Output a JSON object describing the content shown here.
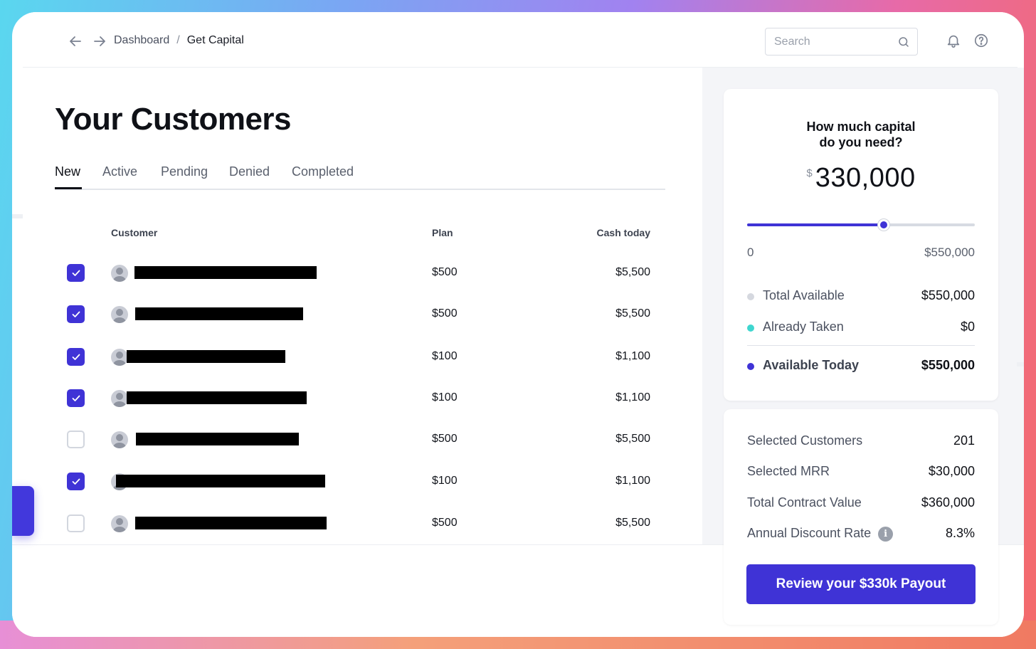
{
  "breadcrumb": {
    "parent": "Dashboard",
    "separator": "/",
    "current": "Get Capital"
  },
  "search": {
    "placeholder": "Search",
    "value": ""
  },
  "page": {
    "title": "Your Customers"
  },
  "tabs": [
    {
      "label": "New",
      "active": true
    },
    {
      "label": "Active",
      "active": false
    },
    {
      "label": "Pending",
      "active": false
    },
    {
      "label": "Denied",
      "active": false
    },
    {
      "label": "Completed",
      "active": false
    }
  ],
  "table": {
    "headers": {
      "customer": "Customer",
      "plan": "Plan",
      "cash": "Cash today"
    },
    "rows": [
      {
        "checked": true,
        "name": "[redacted]",
        "plan": "$500",
        "cash": "$5,500"
      },
      {
        "checked": true,
        "name": "[redacted]",
        "plan": "$500",
        "cash": "$5,500"
      },
      {
        "checked": true,
        "name": "[redacted]",
        "plan": "$100",
        "cash": "$1,100"
      },
      {
        "checked": true,
        "name": "[redacted]",
        "plan": "$100",
        "cash": "$1,100"
      },
      {
        "checked": false,
        "name": "[redacted]",
        "plan": "$500",
        "cash": "$5,500"
      },
      {
        "checked": true,
        "name": "[redacted]",
        "plan": "$100",
        "cash": "$1,100"
      },
      {
        "checked": false,
        "name": "[redacted]",
        "plan": "$500",
        "cash": "$5,500"
      }
    ]
  },
  "capital": {
    "question_line1": "How much capital",
    "question_line2": "do you need?",
    "currency": "$",
    "amount": "330,000",
    "slider_fraction": 0.6,
    "range_min": "0",
    "range_max": "$550,000",
    "stats": [
      {
        "label": "Total Available",
        "value": "$550,000",
        "color": "#d5d8df"
      },
      {
        "label": "Already Taken",
        "value": "$0",
        "color": "#3fd6cf"
      },
      {
        "label": "Available Today",
        "value": "$550,000",
        "color": "#3f33d6"
      }
    ]
  },
  "summary": {
    "items": [
      {
        "label": "Selected Customers",
        "value": "201"
      },
      {
        "label": "Selected MRR",
        "value": "$30,000"
      },
      {
        "label": "Total Contract Value",
        "value": "$360,000"
      },
      {
        "label": "Annual Discount Rate",
        "value": "8.3%",
        "info_icon": "info-icon"
      }
    ],
    "cta_label": "Review your $330k Payout"
  },
  "colors": {
    "accent": "#3f33d6",
    "teal": "#3fd6cf"
  }
}
